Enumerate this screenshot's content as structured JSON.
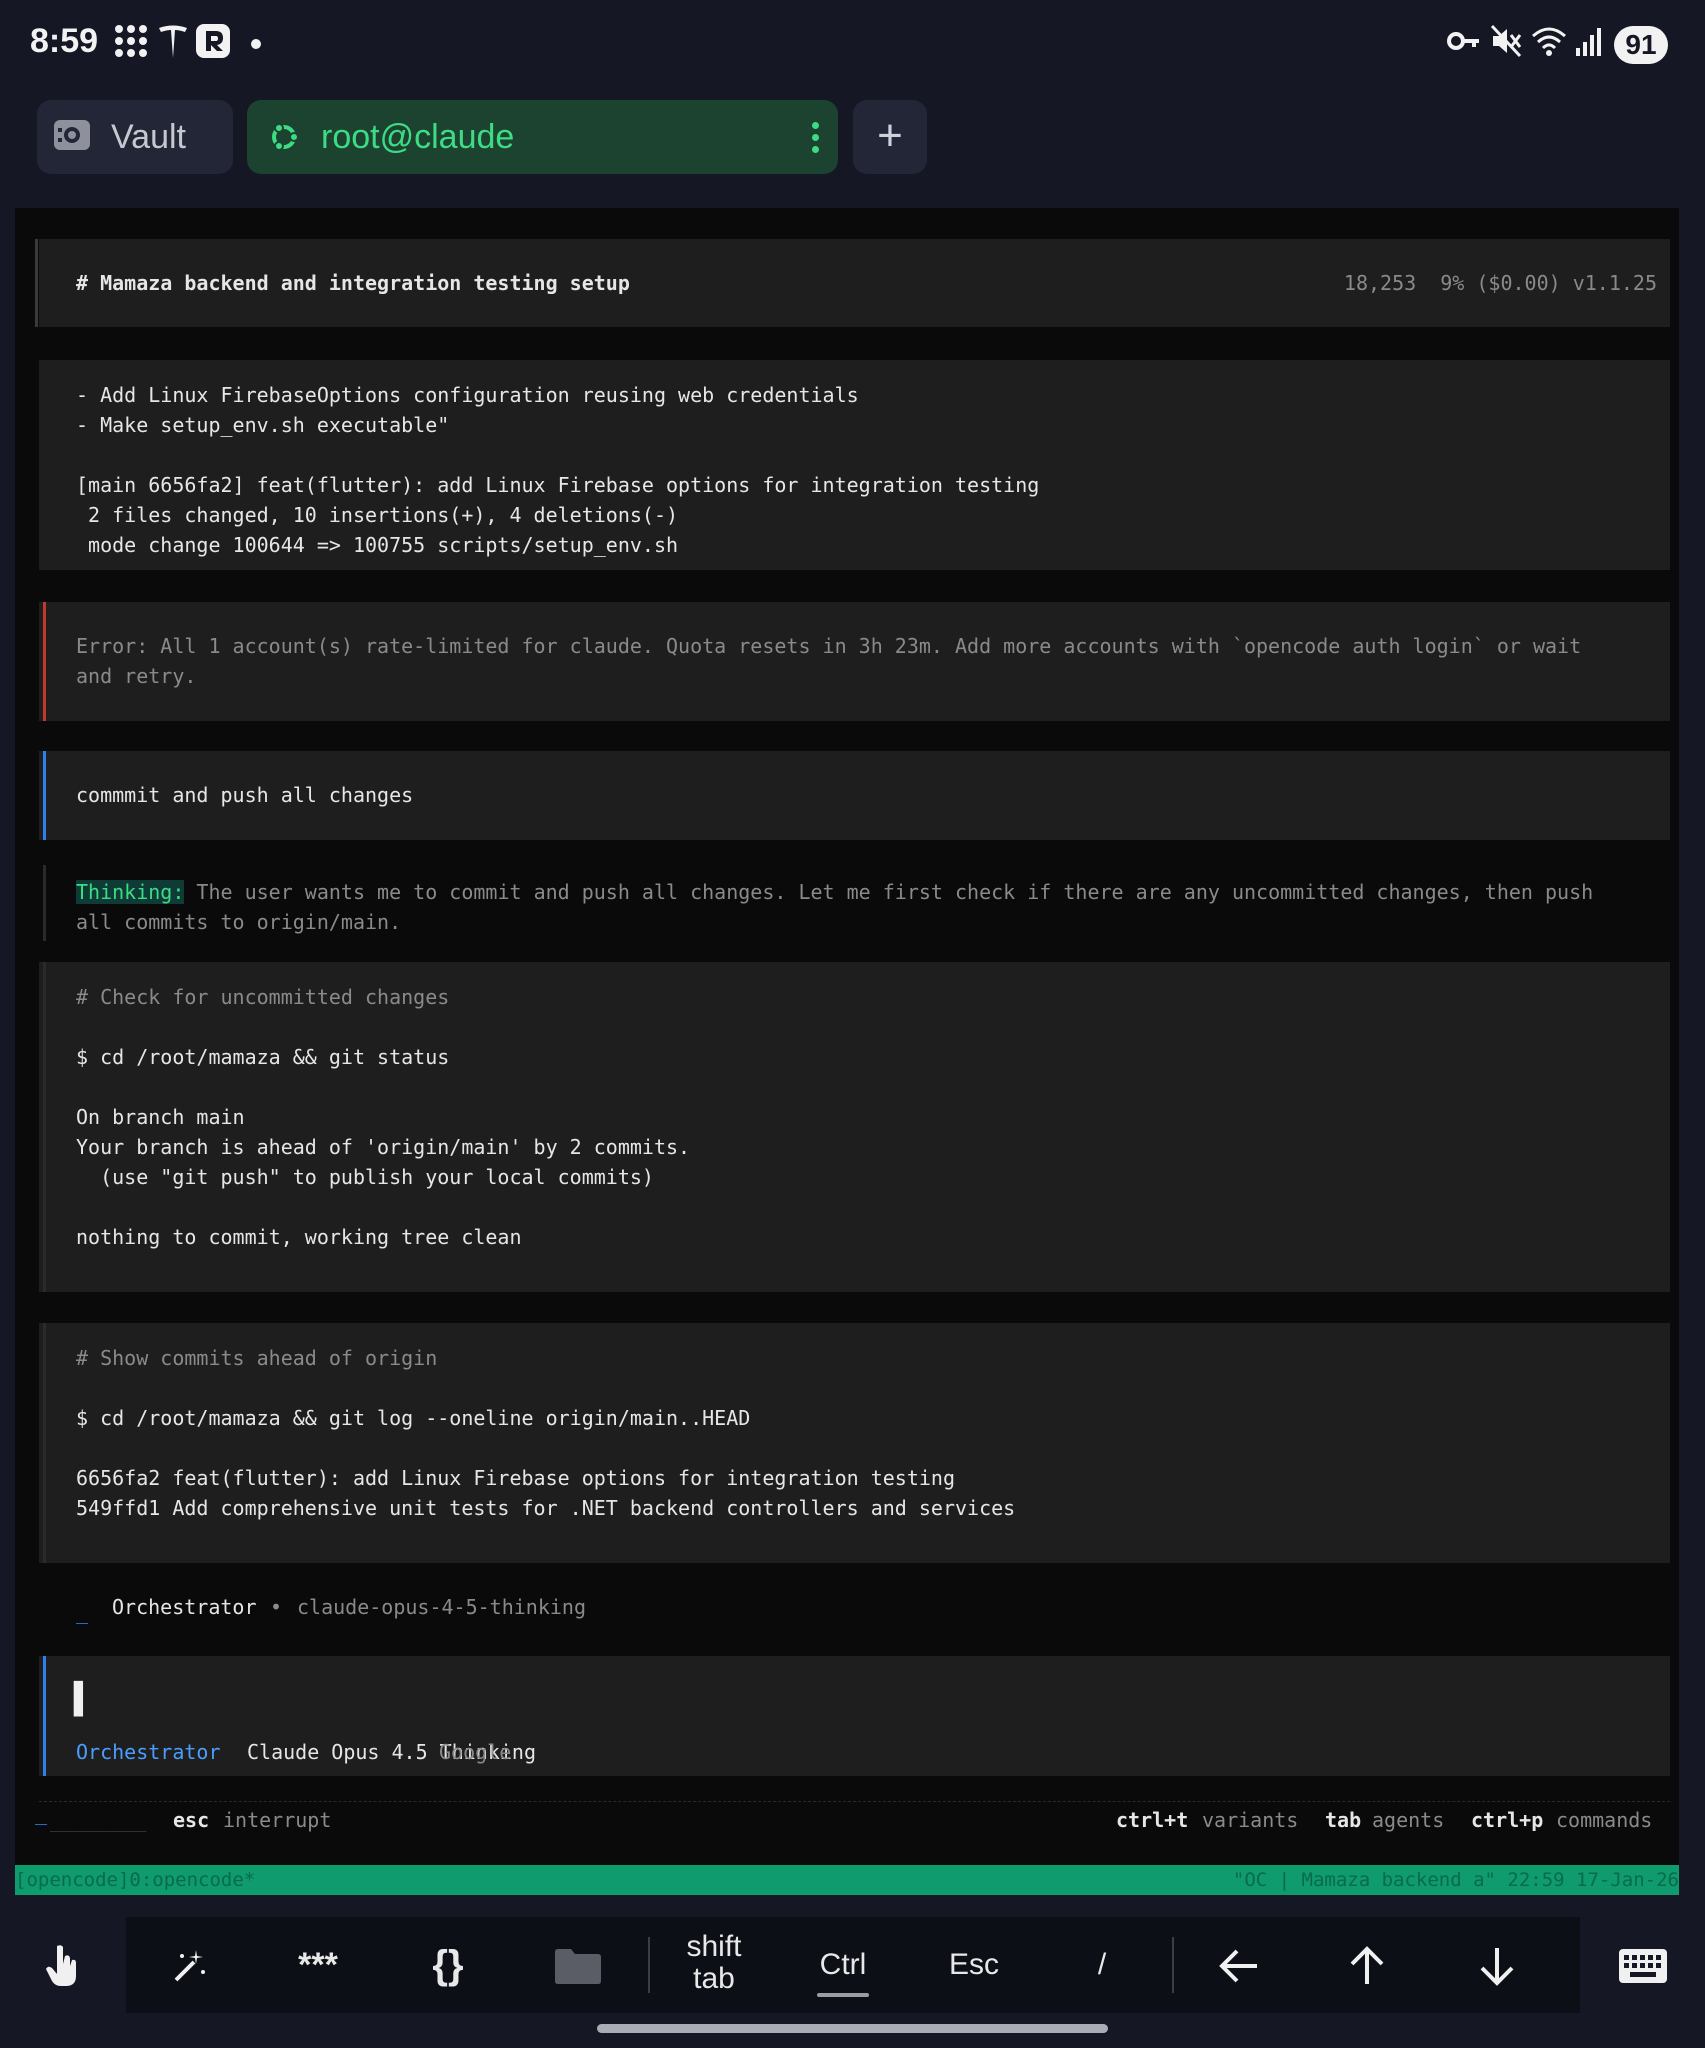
{
  "status_bar": {
    "time": "8:59",
    "battery": "91",
    "left_icons": [
      "grid-dots-icon",
      "tesla-icon",
      "r-app-icon",
      "dot-icon"
    ],
    "right_icons": [
      "vpn-key-icon",
      "mute-icon",
      "wifi-icon",
      "signal-icon"
    ]
  },
  "tabs": [
    {
      "label": "Vault",
      "icon": "vault-icon",
      "active": false
    },
    {
      "label": "root@claude",
      "icon": "ubuntu-icon",
      "active": true
    }
  ],
  "colors": {
    "accent_green": "#3ddc84",
    "error_bar": "#c0392b",
    "user_bar": "#2f80ed",
    "thinking_highlight": "#0e3b36",
    "tmux_green": "#0f9b6e"
  },
  "terminal": {
    "header": {
      "title": "# Mamaza backend and integration testing setup",
      "stats": "18,253  9% ($0.00) v1.1.25"
    },
    "commit_output": [
      "- Add Linux FirebaseOptions configuration reusing web credentials",
      "- Make setup_env.sh executable\"",
      "",
      "[main 6656fa2] feat(flutter): add Linux Firebase options for integration testing",
      " 2 files changed, 10 insertions(+), 4 deletions(-)",
      " mode change 100644 => 100755 scripts/setup_env.sh"
    ],
    "error": [
      "Error: All 1 account(s) rate-limited for claude. Quota resets in 3h 23m. Add more accounts with `opencode auth login` or wait",
      "and retry."
    ],
    "user_message": "commmit and push all changes",
    "thinking": {
      "label": "Thinking:",
      "line1": " The user wants me to commit and push all changes. Let me first check if there are any uncommitted changes, then push",
      "line2": "all commits to origin/main."
    },
    "tool1": {
      "comment": "# Check for uncommitted changes",
      "command": "$ cd /root/mamaza && git status",
      "output": [
        "On branch main",
        "Your branch is ahead of 'origin/main' by 2 commits.",
        "  (use \"git push\" to publish your local commits)",
        "",
        "nothing to commit, working tree clean"
      ]
    },
    "tool2": {
      "comment": "# Show commits ahead of origin",
      "command": "$ cd /root/mamaza && git log --oneline origin/main..HEAD",
      "output": [
        "6656fa2 feat(flutter): add Linux Firebase options for integration testing",
        "549ffd1 Add comprehensive unit tests for .NET backend controllers and services"
      ]
    },
    "agent_status": {
      "spinner": "_",
      "agent": "Orchestrator",
      "separator": "•",
      "model": "claude-opus-4-5-thinking"
    },
    "prompt": {
      "cursor": "▌",
      "agent": "Orchestrator",
      "model": "Claude Opus 4.5 Thinking",
      "provider": "Google"
    },
    "footer": {
      "progress": "________",
      "esc_key": "esc",
      "esc_label": "interrupt",
      "hints": [
        {
          "key": "ctrl+t",
          "label": "variants"
        },
        {
          "key": "tab",
          "label": "agents"
        },
        {
          "key": "ctrl+p",
          "label": "commands"
        }
      ]
    },
    "tmux": {
      "left": "[opencode]0:opencode*",
      "right": "\"OC | Mamaza backend a\" 22:59 17-Jan-26"
    }
  },
  "extra_keys": [
    {
      "label": "",
      "icon": "touch-hand-icon"
    },
    {
      "label": "",
      "icon": "magic-wand-icon"
    },
    {
      "label": "***",
      "icon": ""
    },
    {
      "label": "{}",
      "icon": ""
    },
    {
      "label": "",
      "icon": "folder-icon"
    },
    {
      "label": "shift\ntab",
      "line1": "shift",
      "line2": "tab"
    },
    {
      "label": "Ctrl",
      "active": true
    },
    {
      "label": "Esc"
    },
    {
      "label": "/"
    },
    {
      "label": "←",
      "icon": "arrow-left-icon"
    },
    {
      "label": "↑",
      "icon": "arrow-up-icon"
    },
    {
      "label": "↓",
      "icon": "arrow-down-icon"
    },
    {
      "label": "",
      "icon": "keyboard-icon"
    }
  ]
}
